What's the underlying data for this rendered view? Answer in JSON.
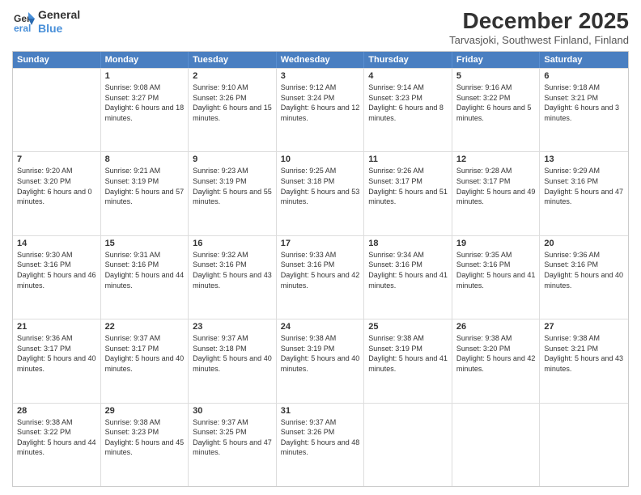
{
  "header": {
    "logo_line1": "General",
    "logo_line2": "Blue",
    "month_title": "December 2025",
    "location": "Tarvasjoki, Southwest Finland, Finland"
  },
  "weekdays": [
    "Sunday",
    "Monday",
    "Tuesday",
    "Wednesday",
    "Thursday",
    "Friday",
    "Saturday"
  ],
  "rows": [
    [
      {
        "day": "",
        "empty": true
      },
      {
        "day": "1",
        "rise": "9:08 AM",
        "set": "3:27 PM",
        "daylight": "6 hours and 18 minutes."
      },
      {
        "day": "2",
        "rise": "9:10 AM",
        "set": "3:26 PM",
        "daylight": "6 hours and 15 minutes."
      },
      {
        "day": "3",
        "rise": "9:12 AM",
        "set": "3:24 PM",
        "daylight": "6 hours and 12 minutes."
      },
      {
        "day": "4",
        "rise": "9:14 AM",
        "set": "3:23 PM",
        "daylight": "6 hours and 8 minutes."
      },
      {
        "day": "5",
        "rise": "9:16 AM",
        "set": "3:22 PM",
        "daylight": "6 hours and 5 minutes."
      },
      {
        "day": "6",
        "rise": "9:18 AM",
        "set": "3:21 PM",
        "daylight": "6 hours and 3 minutes."
      }
    ],
    [
      {
        "day": "7",
        "rise": "9:20 AM",
        "set": "3:20 PM",
        "daylight": "6 hours and 0 minutes."
      },
      {
        "day": "8",
        "rise": "9:21 AM",
        "set": "3:19 PM",
        "daylight": "5 hours and 57 minutes."
      },
      {
        "day": "9",
        "rise": "9:23 AM",
        "set": "3:19 PM",
        "daylight": "5 hours and 55 minutes."
      },
      {
        "day": "10",
        "rise": "9:25 AM",
        "set": "3:18 PM",
        "daylight": "5 hours and 53 minutes."
      },
      {
        "day": "11",
        "rise": "9:26 AM",
        "set": "3:17 PM",
        "daylight": "5 hours and 51 minutes."
      },
      {
        "day": "12",
        "rise": "9:28 AM",
        "set": "3:17 PM",
        "daylight": "5 hours and 49 minutes."
      },
      {
        "day": "13",
        "rise": "9:29 AM",
        "set": "3:16 PM",
        "daylight": "5 hours and 47 minutes."
      }
    ],
    [
      {
        "day": "14",
        "rise": "9:30 AM",
        "set": "3:16 PM",
        "daylight": "5 hours and 46 minutes."
      },
      {
        "day": "15",
        "rise": "9:31 AM",
        "set": "3:16 PM",
        "daylight": "5 hours and 44 minutes."
      },
      {
        "day": "16",
        "rise": "9:32 AM",
        "set": "3:16 PM",
        "daylight": "5 hours and 43 minutes."
      },
      {
        "day": "17",
        "rise": "9:33 AM",
        "set": "3:16 PM",
        "daylight": "5 hours and 42 minutes."
      },
      {
        "day": "18",
        "rise": "9:34 AM",
        "set": "3:16 PM",
        "daylight": "5 hours and 41 minutes."
      },
      {
        "day": "19",
        "rise": "9:35 AM",
        "set": "3:16 PM",
        "daylight": "5 hours and 41 minutes."
      },
      {
        "day": "20",
        "rise": "9:36 AM",
        "set": "3:16 PM",
        "daylight": "5 hours and 40 minutes."
      }
    ],
    [
      {
        "day": "21",
        "rise": "9:36 AM",
        "set": "3:17 PM",
        "daylight": "5 hours and 40 minutes."
      },
      {
        "day": "22",
        "rise": "9:37 AM",
        "set": "3:17 PM",
        "daylight": "5 hours and 40 minutes."
      },
      {
        "day": "23",
        "rise": "9:37 AM",
        "set": "3:18 PM",
        "daylight": "5 hours and 40 minutes."
      },
      {
        "day": "24",
        "rise": "9:38 AM",
        "set": "3:19 PM",
        "daylight": "5 hours and 40 minutes."
      },
      {
        "day": "25",
        "rise": "9:38 AM",
        "set": "3:19 PM",
        "daylight": "5 hours and 41 minutes."
      },
      {
        "day": "26",
        "rise": "9:38 AM",
        "set": "3:20 PM",
        "daylight": "5 hours and 42 minutes."
      },
      {
        "day": "27",
        "rise": "9:38 AM",
        "set": "3:21 PM",
        "daylight": "5 hours and 43 minutes."
      }
    ],
    [
      {
        "day": "28",
        "rise": "9:38 AM",
        "set": "3:22 PM",
        "daylight": "5 hours and 44 minutes."
      },
      {
        "day": "29",
        "rise": "9:38 AM",
        "set": "3:23 PM",
        "daylight": "5 hours and 45 minutes."
      },
      {
        "day": "30",
        "rise": "9:37 AM",
        "set": "3:25 PM",
        "daylight": "5 hours and 47 minutes."
      },
      {
        "day": "31",
        "rise": "9:37 AM",
        "set": "3:26 PM",
        "daylight": "5 hours and 48 minutes."
      },
      {
        "day": "",
        "empty": true
      },
      {
        "day": "",
        "empty": true
      },
      {
        "day": "",
        "empty": true
      }
    ]
  ]
}
